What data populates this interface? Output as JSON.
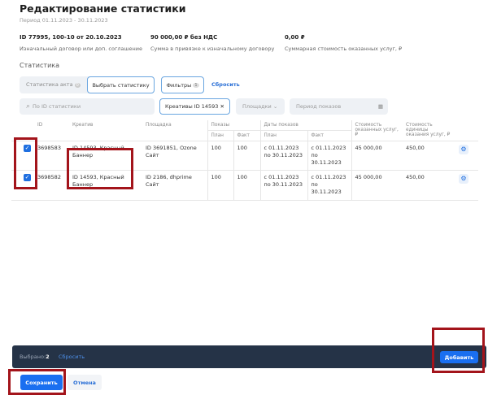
{
  "header": {
    "title": "Редактирование статистики",
    "period": "Период 01.11.2023 - 30.11.2023"
  },
  "info": [
    {
      "value": "ID 77995, 100-10 от 20.10.2023",
      "label": "Изначальный договор или доп. соглашение"
    },
    {
      "value": "90 000,00 ₽ без НДС",
      "label": "Сумма в привязке к изначальному договору"
    },
    {
      "value": "0,00 ₽",
      "label": "Суммарная стоимость оказанных услуг, ₽"
    }
  ],
  "section": "Статистика",
  "toolbar": {
    "act_stats": "Статистика акта",
    "act_stats_badge": "0",
    "choose_stats": "Выбрать статистику",
    "filters": "Фильтры",
    "filters_badge": "1",
    "reset": "Сбросить"
  },
  "filters": {
    "search_placeholder": "По ID статистики",
    "creative_chip": "Креативы ID 14593",
    "platforms": "Площадки",
    "period_placeholder": "Период показов"
  },
  "table": {
    "headers": {
      "id": "ID",
      "creative": "Креатив",
      "platform": "Площадка",
      "shows": "Показы",
      "dates": "Даты показов",
      "plan": "План",
      "fact": "Факт",
      "cost": "Стоимость оказанных услуг, ₽",
      "unit_cost": "Стоимость единицы оказания услуг, ₽"
    },
    "rows": [
      {
        "checked": true,
        "id": "3698583",
        "creative": "ID 14593, Красный Баннер",
        "platform": "ID 3691851, Ozone Сайт",
        "plan": "100",
        "fact": "100",
        "date_plan": "с 01.11.2023 по 30.11.2023",
        "date_fact": "с 01.11.2023 по 30.11.2023",
        "cost": "45 000,00",
        "unit_cost": "450,00"
      },
      {
        "checked": true,
        "id": "3698582",
        "creative": "ID 14593, Красный Баннер",
        "platform": "ID 2186, dhprime Сайт",
        "plan": "100",
        "fact": "100",
        "date_plan": "с 01.11.2023 по 30.11.2023",
        "date_fact": "с 01.11.2023 по 30.11.2023",
        "cost": "45 000,00",
        "unit_cost": "450,00"
      }
    ]
  },
  "selection_bar": {
    "selected_label": "Выбрано:",
    "selected_count": "2",
    "reset": "Сбросить",
    "add": "Добавить"
  },
  "footer": {
    "save": "Сохранить",
    "cancel": "Отмена"
  },
  "colors": {
    "primary": "#1a6ff0",
    "bar": "#253347",
    "highlight": "#a3141b"
  }
}
